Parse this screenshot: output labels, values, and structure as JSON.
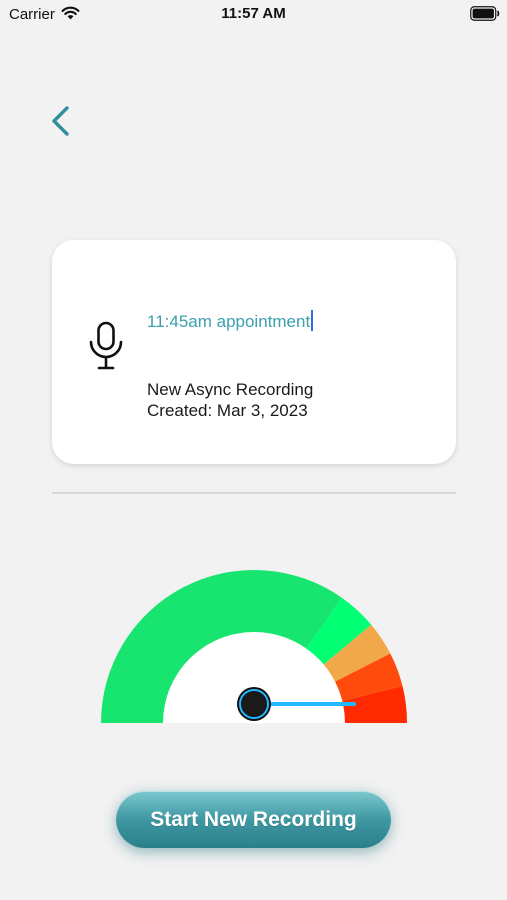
{
  "status_bar": {
    "carrier": "Carrier",
    "time": "11:57 AM",
    "icons": [
      "wifi-icon",
      "battery-icon"
    ]
  },
  "nav": {
    "back_icon": "chevron-left-icon"
  },
  "recording_card": {
    "icon": "microphone-icon",
    "title_value": "11:45am appointment",
    "subtitle": "New Async Recording",
    "created": "Created: Mar 3, 2023"
  },
  "gauge": {
    "needle_level": 0.0,
    "zones": [
      "bright-green",
      "green",
      "orange",
      "red-orange",
      "red"
    ]
  },
  "start_button": {
    "label": "Start New Recording"
  },
  "colors": {
    "accent": "#3aa0ad",
    "button": "#3f98a2",
    "gauge_green": "#18e56f",
    "gauge_bright_green": "#00ff73",
    "gauge_orange": "#f1a84a",
    "gauge_red_orange": "#ff4c0d",
    "gauge_red": "#ff2a00",
    "needle": "#20b8ff"
  }
}
